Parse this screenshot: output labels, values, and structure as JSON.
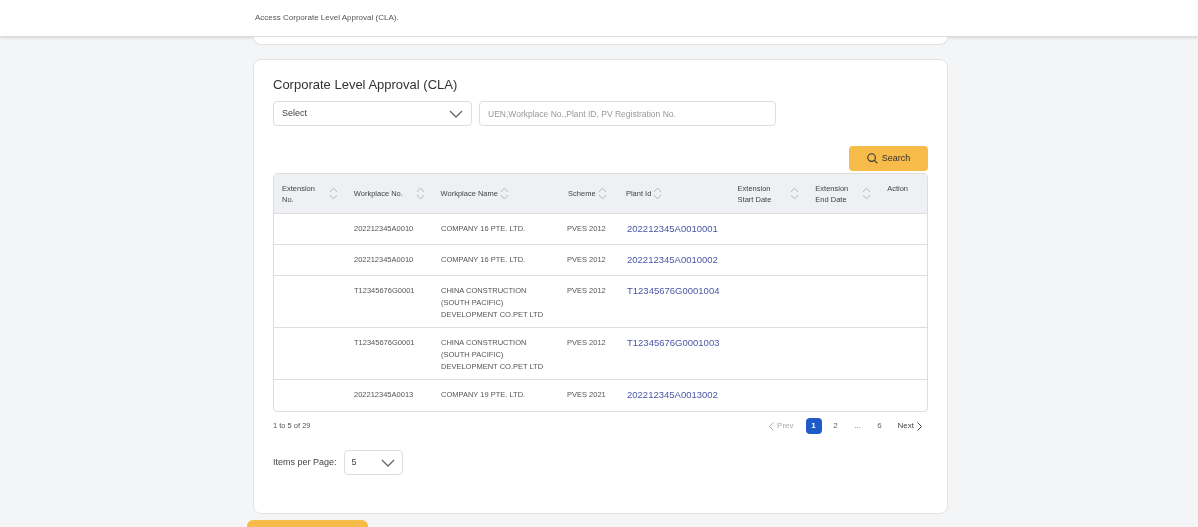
{
  "header": {
    "description": "Access Corporate Level Approval (CLA)."
  },
  "panel": {
    "title": "Corporate Level Approval (CLA)",
    "select": {
      "value": "Select"
    },
    "search_field": {
      "placeholder": "UEN,Workplace No.,Plant ID, PV Registration No."
    },
    "search_button": "Search",
    "table": {
      "columns": [
        {
          "label": "Extension No.",
          "sortable": true
        },
        {
          "label": "Workplace No.",
          "sortable": true
        },
        {
          "label": "Workplace Name",
          "sortable": true
        },
        {
          "label": "Scheme",
          "sortable": true
        },
        {
          "label": "Plant Id",
          "sortable": true
        },
        {
          "label": "Extension Start Date",
          "sortable": true
        },
        {
          "label": "Extension End Date",
          "sortable": true
        },
        {
          "label": "Action",
          "sortable": false
        }
      ],
      "rows": [
        {
          "workplace_no": "202212345A0010",
          "workplace_name": "COMPANY 16 PTE. LTD.",
          "scheme": "PVES 2012",
          "plant_id": "202212345A0010001"
        },
        {
          "workplace_no": "202212345A0010",
          "workplace_name": "COMPANY 16 PTE. LTD.",
          "scheme": "PVES 2012",
          "plant_id": "202212345A0010002"
        },
        {
          "workplace_no": "T12345676G0001",
          "workplace_name": "CHINA CONSTRUCTION (SOUTH PACIFIC) DEVELOPMENT CO.PET LTD",
          "scheme": "PVES 2012",
          "plant_id": "T12345676G0001004"
        },
        {
          "workplace_no": "T12345676G0001",
          "workplace_name": "CHINA CONSTRUCTION (SOUTH PACIFIC) DEVELOPMENT CO.PET LTD",
          "scheme": "PVES 2012",
          "plant_id": "T12345676G0001003"
        },
        {
          "workplace_no": "202212345A0013",
          "workplace_name": "COMPANY 19 PTE. LTD.",
          "scheme": "PVES 2021",
          "plant_id": "202212345A0013002"
        }
      ]
    },
    "range": "1 to 5 of 29",
    "pagination": {
      "prev": {
        "label": "Prev",
        "disabled": true
      },
      "pages": [
        {
          "label": "1",
          "selected": true
        },
        {
          "label": "2",
          "selected": false
        },
        {
          "label": "...",
          "selected": false
        },
        {
          "label": "6",
          "selected": false
        }
      ],
      "next": {
        "label": "Next",
        "disabled": false
      }
    },
    "items_per_page": {
      "label": "Items per Page:",
      "value": "5"
    }
  }
}
